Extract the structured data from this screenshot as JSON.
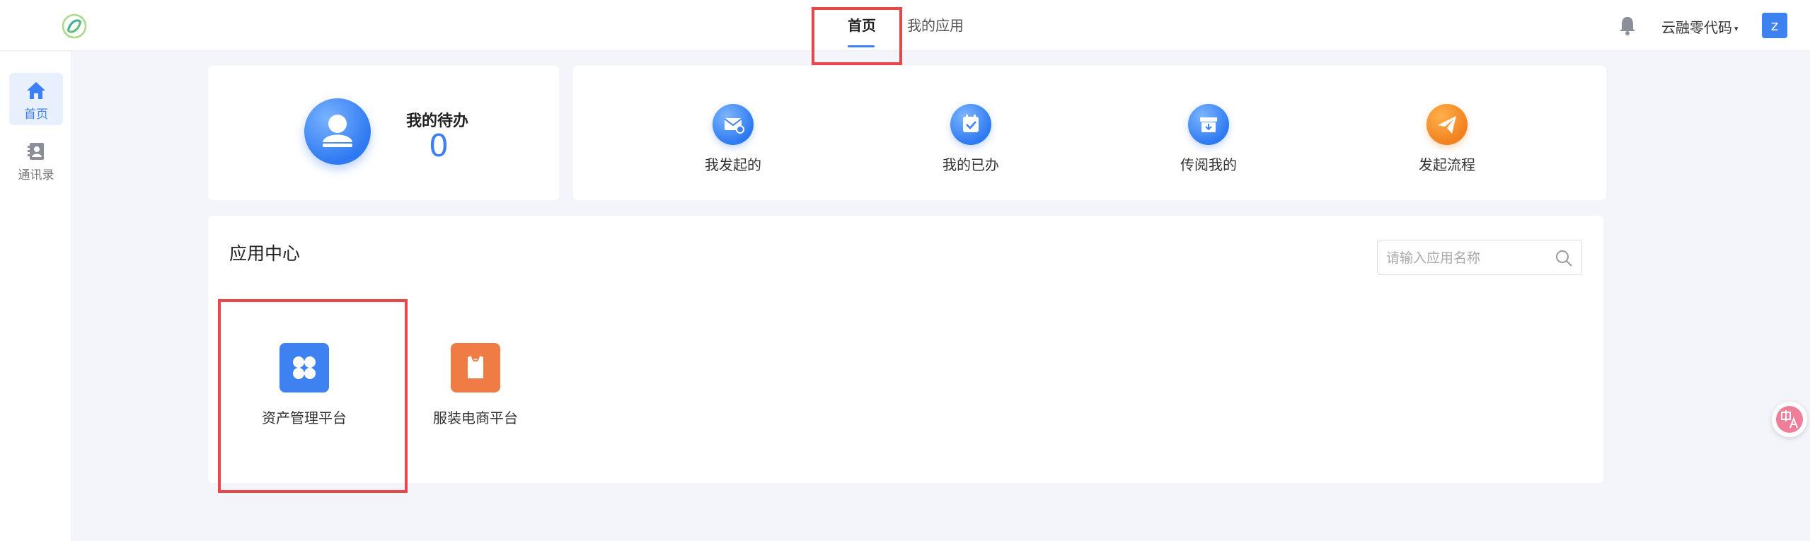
{
  "header": {
    "tabs": [
      {
        "label": "首页",
        "active": true
      },
      {
        "label": "我的应用",
        "active": false
      }
    ],
    "org_name": "云融零代码",
    "org_caret": "▾",
    "user_initial": "z"
  },
  "sidebar": {
    "items": [
      {
        "label": "首页",
        "icon": "home-icon",
        "active": true
      },
      {
        "label": "通讯录",
        "icon": "contacts-icon",
        "active": false
      }
    ]
  },
  "todo": {
    "title": "我的待办",
    "count": "0"
  },
  "quick_actions": [
    {
      "label": "我发起的",
      "icon": "mail-icon"
    },
    {
      "label": "我的已办",
      "icon": "calendar-check-icon"
    },
    {
      "label": "传阅我的",
      "icon": "inbox-icon"
    },
    {
      "label": "发起流程",
      "icon": "paper-plane-icon"
    }
  ],
  "app_center": {
    "title": "应用中心",
    "search_placeholder": "请输入应用名称",
    "apps": [
      {
        "label": "资产管理平台",
        "icon": "four-leaf-icon",
        "color": "#3d82f0"
      },
      {
        "label": "服装电商平台",
        "icon": "shirt-icon",
        "color": "#ef7b45"
      }
    ]
  },
  "colors": {
    "accent": "#3d7ff5",
    "highlight_box": "#e8464b"
  }
}
